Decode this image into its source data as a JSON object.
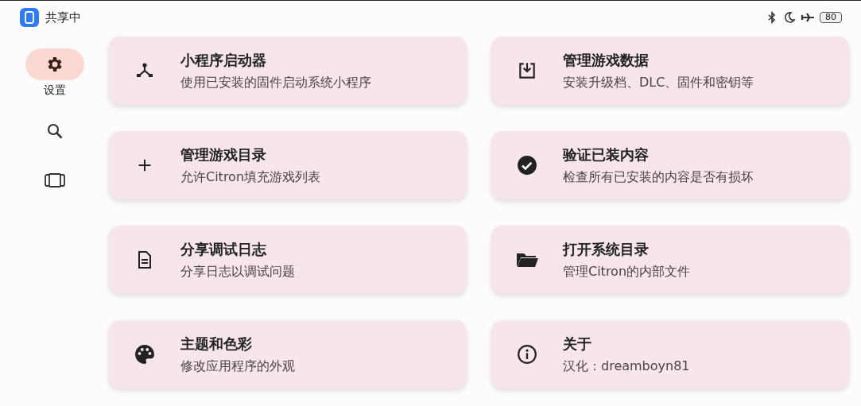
{
  "status_bar": {
    "app_label": "共享中",
    "battery": "80"
  },
  "sidebar": {
    "items": [
      {
        "kind": "settings",
        "label": "设置",
        "selected": true
      },
      {
        "kind": "search",
        "selected": false
      },
      {
        "kind": "library",
        "selected": false
      }
    ]
  },
  "cards": [
    {
      "kind": "applet",
      "title": "小程序启动器",
      "description": "使用已安装的固件启动系统小程序"
    },
    {
      "kind": "install",
      "title": "管理游戏数据",
      "description": "安装升级档、DLC、固件和密钥等"
    },
    {
      "kind": "add",
      "title": "管理游戏目录",
      "description": "允许Citron填充游戏列表"
    },
    {
      "kind": "verify",
      "title": "验证已装内容",
      "description": "检查所有已安装的内容是否有损坏"
    },
    {
      "kind": "log",
      "title": "分享调试日志",
      "description": "分享日志以调试问题"
    },
    {
      "kind": "folder",
      "title": "打开系统目录",
      "description": "管理Citron的内部文件"
    },
    {
      "kind": "theme",
      "title": "主题和色彩",
      "description": "修改应用程序的外观"
    },
    {
      "kind": "about",
      "title": "关于",
      "description": "汉化：dreamboyn81"
    }
  ]
}
